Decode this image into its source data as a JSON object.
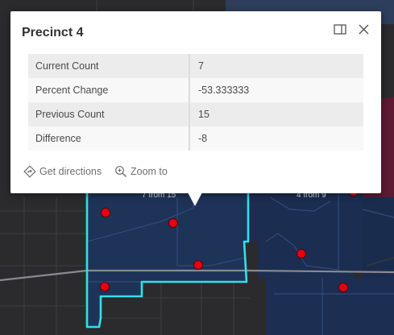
{
  "popup": {
    "title": "Precinct 4",
    "fields": [
      {
        "name": "Current Count",
        "value": "7"
      },
      {
        "name": "Percent Change",
        "value": "-53.333333"
      },
      {
        "name": "Previous Count",
        "value": "15"
      },
      {
        "name": "Difference",
        "value": "-8"
      }
    ],
    "actions": {
      "directions_label": "Get directions",
      "zoom_label": "Zoom to"
    },
    "icons": {
      "dock": "dock-icon",
      "close": "close-icon",
      "directions": "directions-icon",
      "zoom": "zoom-in-icon"
    }
  },
  "map": {
    "labels": {
      "left_partial": "7 from 15",
      "right_partial": "4 from 9"
    },
    "colors": {
      "basemap": "#2b2b2d",
      "precinct_fill": "#1c2f52",
      "precinct_outline": "#2f4575",
      "selected_outline": "#33e0e8",
      "incident_marker": "#e60012",
      "highlight_fill": "#6b1d38"
    }
  }
}
